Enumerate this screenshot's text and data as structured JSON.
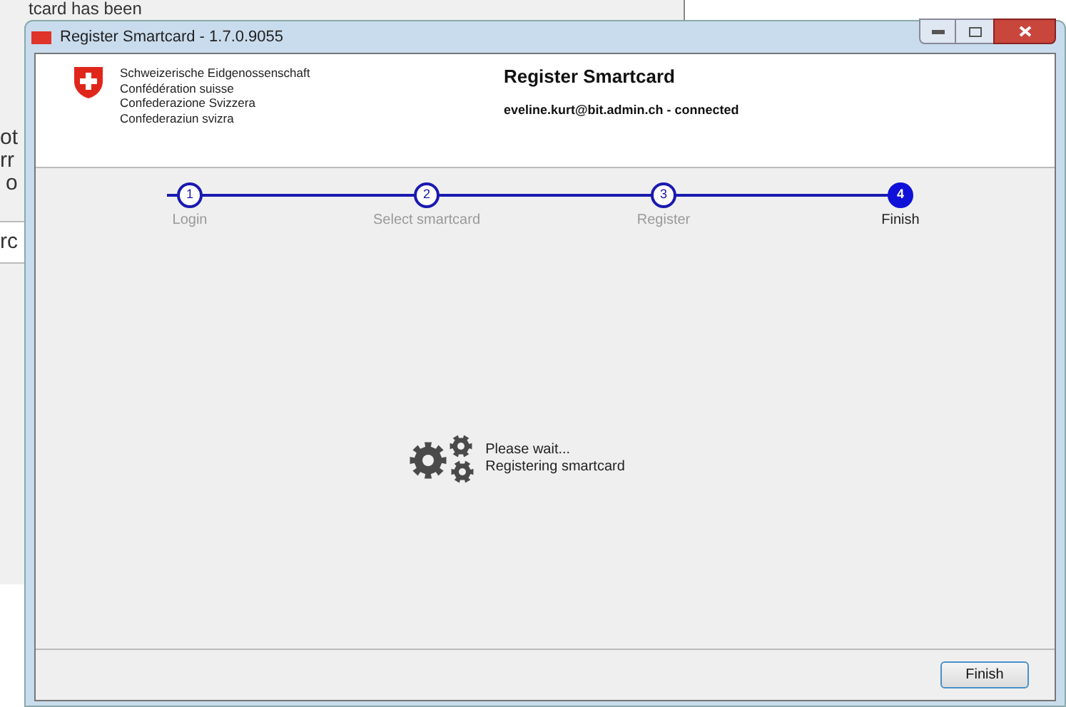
{
  "background_window": {
    "texts": [
      "tcard has been",
      "ot",
      "rr",
      "o",
      "rc"
    ]
  },
  "window": {
    "title": "Register Smartcard - 1.7.0.9055"
  },
  "header": {
    "org_names": [
      "Schweizerische Eidgenossenschaft",
      "Confédération suisse",
      "Confederazione Svizzera",
      "Confederaziun svizra"
    ],
    "title": "Register Smartcard",
    "user": "eveline.kurt@bit.admin.ch - connected"
  },
  "steps": [
    {
      "number": "1",
      "label": "Login",
      "selected": false
    },
    {
      "number": "2",
      "label": "Select smartcard",
      "selected": false
    },
    {
      "number": "3",
      "label": "Register",
      "selected": false
    },
    {
      "number": "4",
      "label": "Finish",
      "selected": true
    }
  ],
  "status": {
    "lines": [
      "Please wait...",
      "Registering smartcard"
    ]
  },
  "buttons": [
    "Finish"
  ]
}
